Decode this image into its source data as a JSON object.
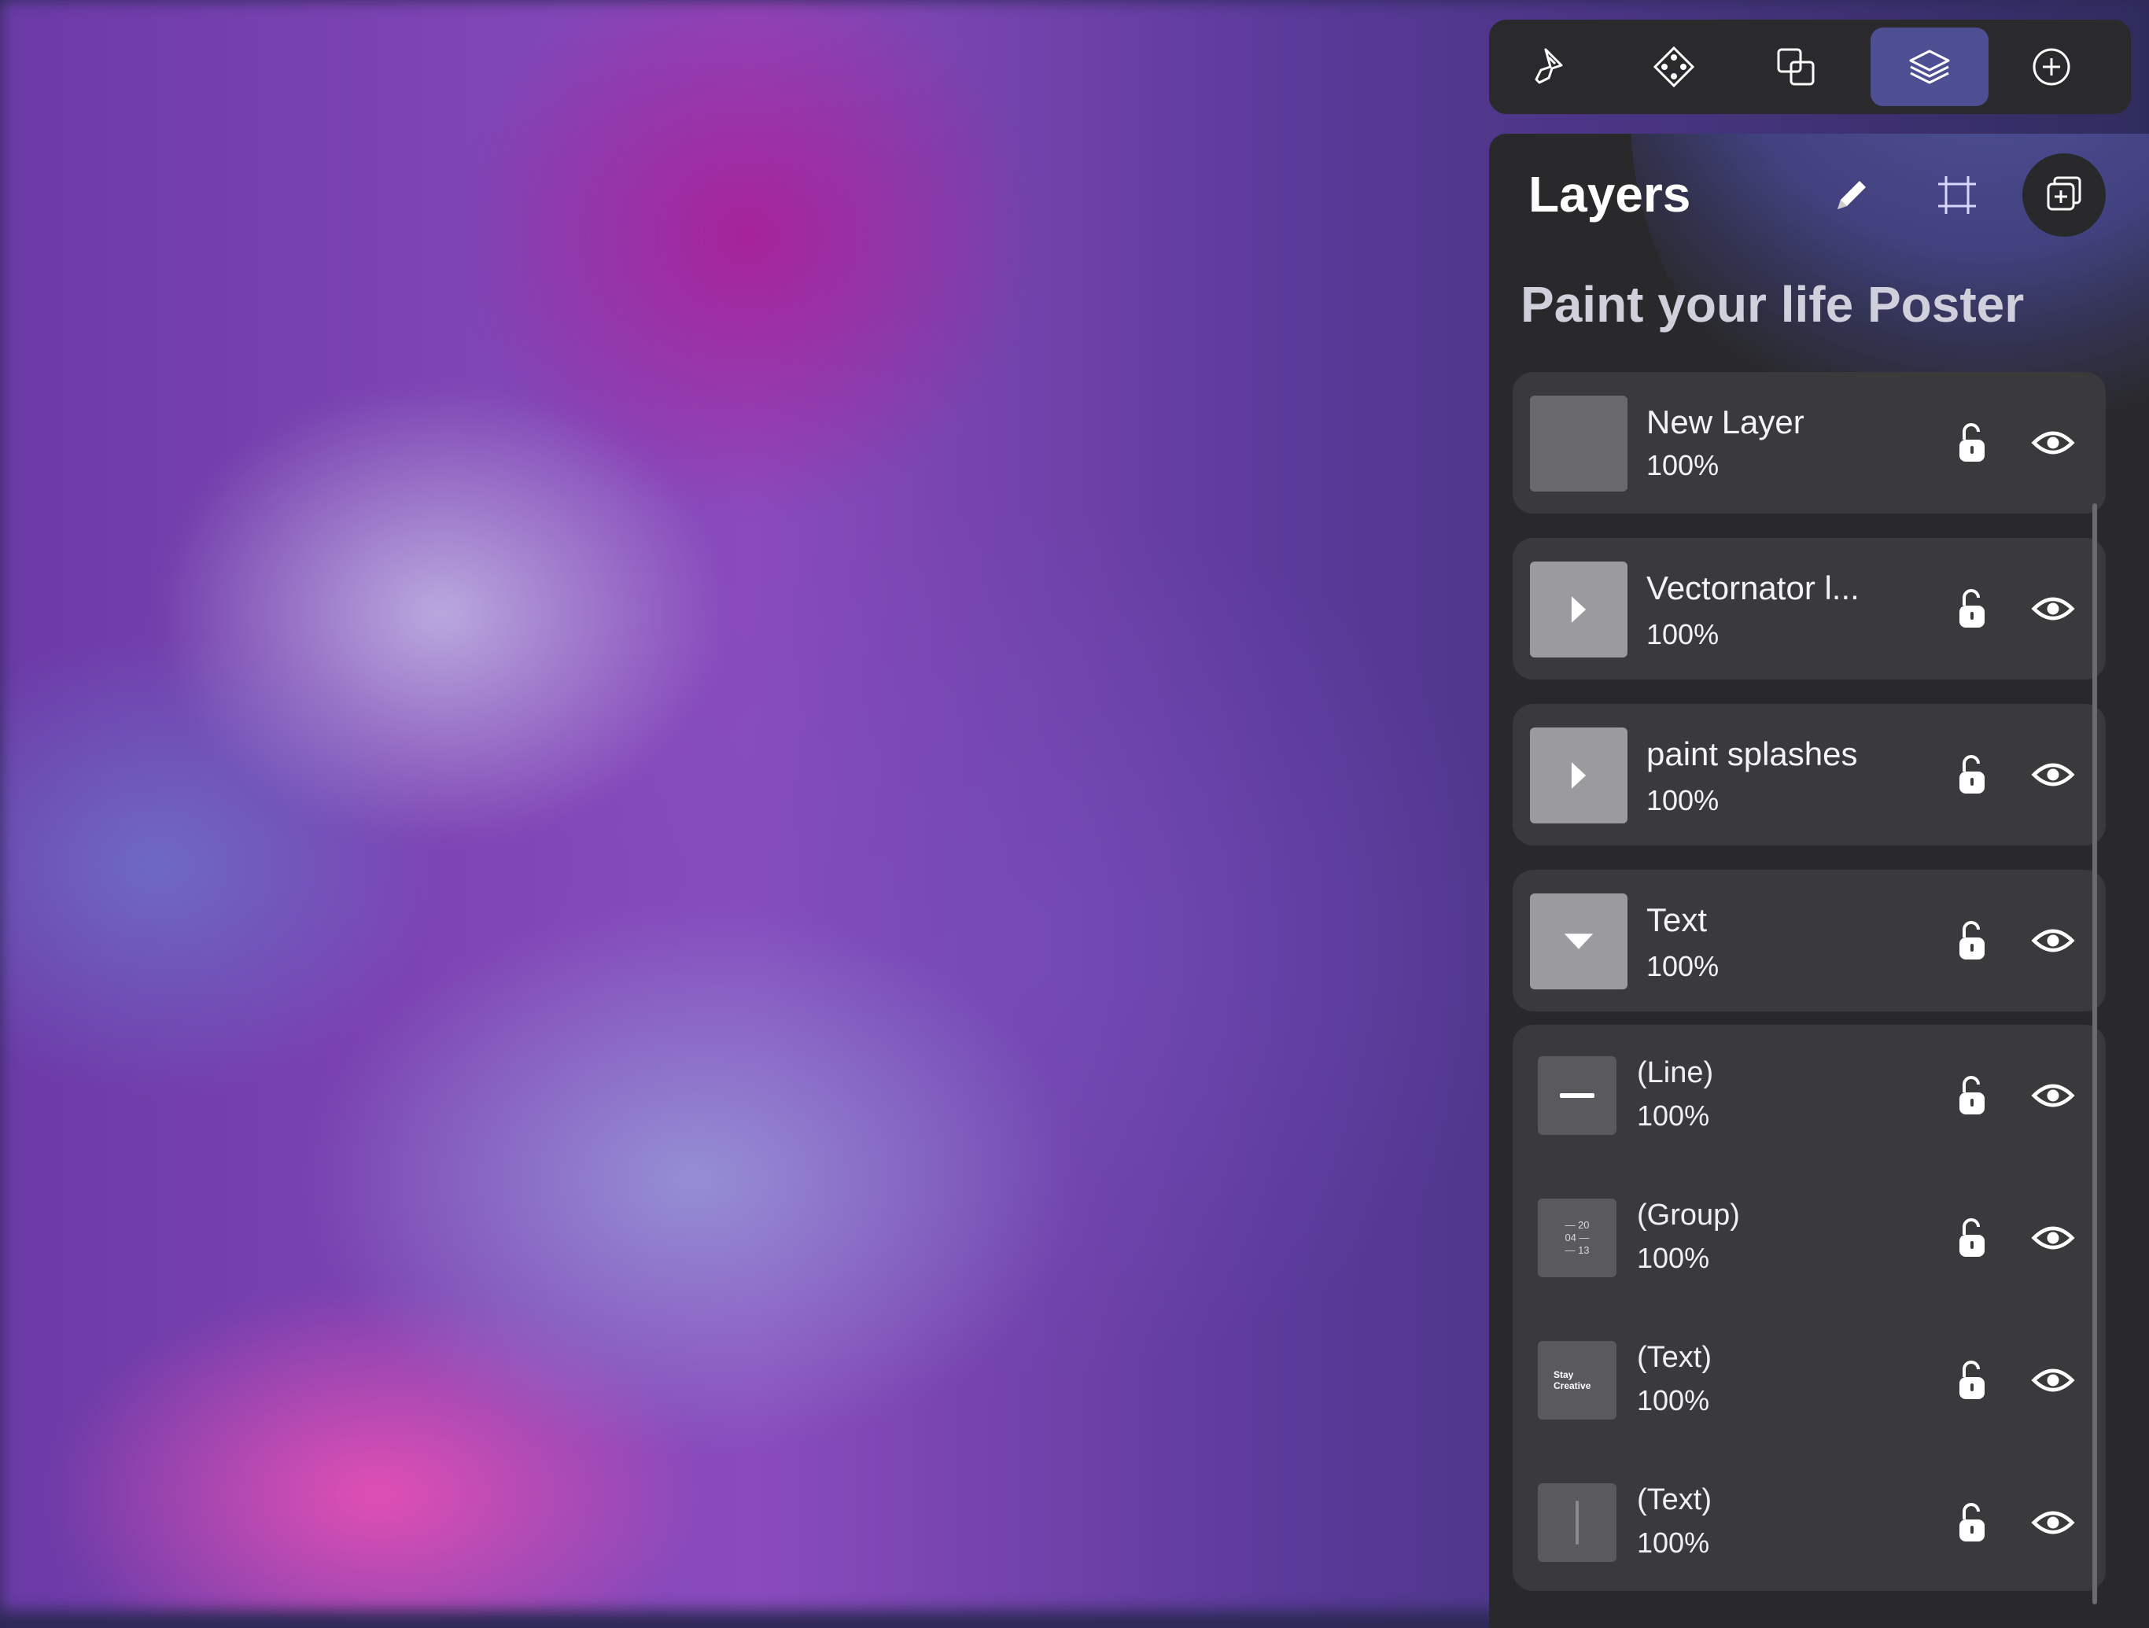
{
  "toolbar": {
    "tools": [
      {
        "icon": "brush-icon"
      },
      {
        "icon": "node-icon"
      },
      {
        "icon": "shapes-icon"
      },
      {
        "icon": "layers-icon",
        "active": true
      },
      {
        "icon": "add-circle-icon"
      }
    ]
  },
  "panel": {
    "title": "Layers",
    "document_title": "Paint your life Poster",
    "header_buttons": [
      "pencil-icon",
      "artboard-icon",
      "add-layer-icon"
    ]
  },
  "layers": [
    {
      "name": "New Layer",
      "opacity": "100%",
      "thumb": "blank"
    },
    {
      "name": "Vectornator l...",
      "opacity": "100%",
      "thumb": "collapsed"
    },
    {
      "name": "paint splashes",
      "opacity": "100%",
      "thumb": "collapsed"
    },
    {
      "name": "Text",
      "opacity": "100%",
      "thumb": "expanded"
    }
  ],
  "sublayers": [
    {
      "name": "(Line)",
      "opacity": "100%",
      "thumb": "line"
    },
    {
      "name": "(Group)",
      "opacity": "100%",
      "thumb": "group",
      "thumb_text": "— 20\n04 —\n— 13"
    },
    {
      "name": "(Text)",
      "opacity": "100%",
      "thumb": "text",
      "thumb_text": "Stay Creative"
    },
    {
      "name": "(Text)",
      "opacity": "100%",
      "thumb": "text-vertical"
    }
  ],
  "colors": {
    "panel_bg": "#29292b",
    "row_bg": "#3a3a3c",
    "active_tool": "#4d4f92",
    "accent_glow": "#6a6af0"
  }
}
